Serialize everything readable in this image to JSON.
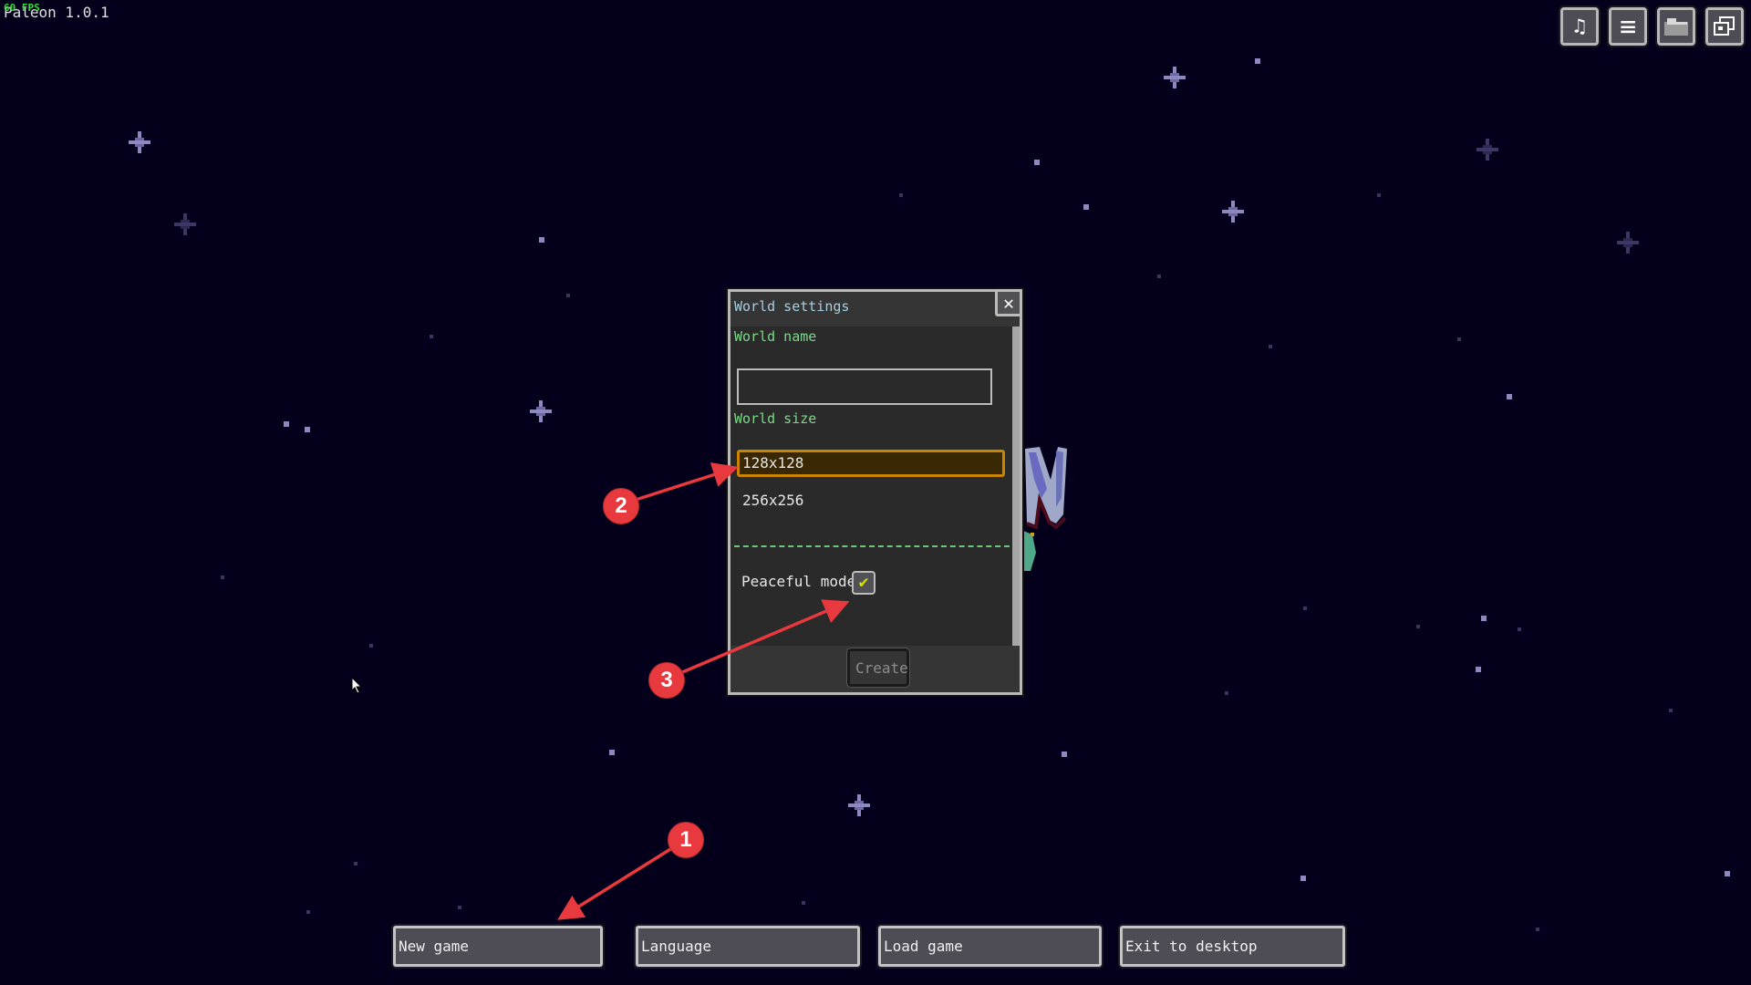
{
  "app": {
    "title": "Paleon 1.0.1",
    "fps": "60 FPS"
  },
  "toolbar": {
    "buttons": [
      {
        "name": "music",
        "icon": "music-note-icon",
        "glyph": "♫"
      },
      {
        "name": "menu",
        "icon": "list-icon",
        "glyph": "≡"
      },
      {
        "name": "folder",
        "icon": "folder-icon",
        "glyph": "▬"
      },
      {
        "name": "window",
        "icon": "window-restore-icon",
        "glyph": "⧉"
      }
    ]
  },
  "dialog": {
    "title": "World settings",
    "close_glyph": "✕",
    "world_name_label": "World name",
    "world_name_value": "",
    "world_size_label": "World size",
    "size_options": [
      "128x128",
      "256x256"
    ],
    "selected_size": "128x128",
    "peaceful_label": "Peaceful mode",
    "peaceful_checked": true,
    "check_glyph": "✔",
    "create_label": "Create",
    "create_enabled": false
  },
  "main_menu": {
    "buttons": [
      "New game",
      "Language",
      "Load game",
      "Exit to desktop"
    ]
  },
  "annotations": [
    {
      "number": "1",
      "target": "New game button"
    },
    {
      "number": "2",
      "target": "128x128 size option"
    },
    {
      "number": "3",
      "target": "Peaceful mode checkbox"
    }
  ],
  "colors": {
    "background": "#04001c",
    "dialog_bg": "#2a2a2a",
    "title_text": "#a9cde0",
    "label_green": "#7ed88a",
    "selected_border": "#c98400",
    "checkmark": "#d8e000",
    "annotation_red": "#e8393e",
    "fps_green": "#2ee02e"
  }
}
